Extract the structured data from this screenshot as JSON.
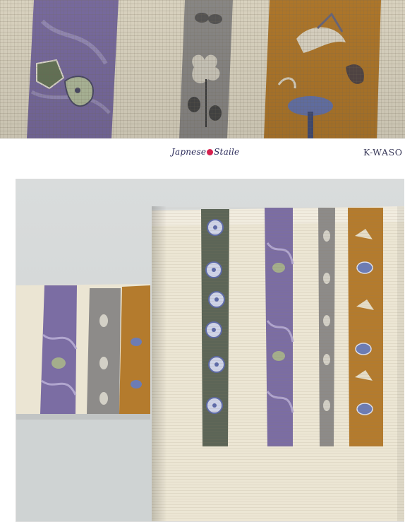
{
  "brand": {
    "left_part1": "Japnese",
    "left_part2": "Staile",
    "right": "K-WASO"
  },
  "photos": {
    "closeup": "obi-textile-closeup",
    "main": "obi-textile-folded"
  },
  "colors": {
    "cream": "#e9e2d0",
    "purple": "#7c6da2",
    "grey": "#8f8d8b",
    "ochre": "#b67c2c",
    "darkgreen": "#5c6557",
    "brand_dot": "#d6204e"
  }
}
